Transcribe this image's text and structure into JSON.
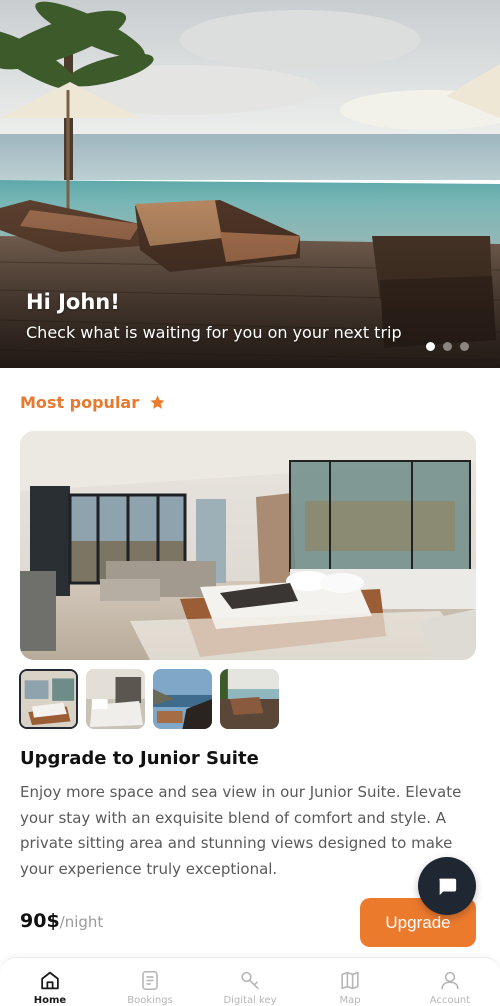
{
  "hero": {
    "greeting": "Hi John!",
    "subtitle": "Check what is waiting for you on your next trip",
    "slides_total": 3,
    "active_slide": 1
  },
  "section": {
    "title": "Most popular",
    "icon": "star-icon"
  },
  "offer": {
    "title": "Upgrade to Junior Suite",
    "description": "Enjoy more space and sea view in our Junior Suite. Elevate your stay with an exquisite blend of comfort and style. A private sitting area and stunning views designed to make your experience truly exceptional.",
    "price": "90$",
    "price_unit": "/night",
    "button_label": "Upgrade",
    "thumbnails_total": 4,
    "active_thumbnail": 1
  },
  "chat": {
    "icon": "chat-bubble-icon"
  },
  "nav": {
    "items": [
      {
        "label": "Home",
        "icon": "home-icon",
        "active": true
      },
      {
        "label": "Bookings",
        "icon": "bookings-icon",
        "active": false
      },
      {
        "label": "Digital key",
        "icon": "key-icon",
        "active": false
      },
      {
        "label": "Map",
        "icon": "map-icon",
        "active": false
      },
      {
        "label": "Account",
        "icon": "account-icon",
        "active": false
      }
    ]
  },
  "colors": {
    "accent": "#ec7a2d",
    "dark": "#1f2733",
    "muted_text": "#5a5a5a"
  }
}
